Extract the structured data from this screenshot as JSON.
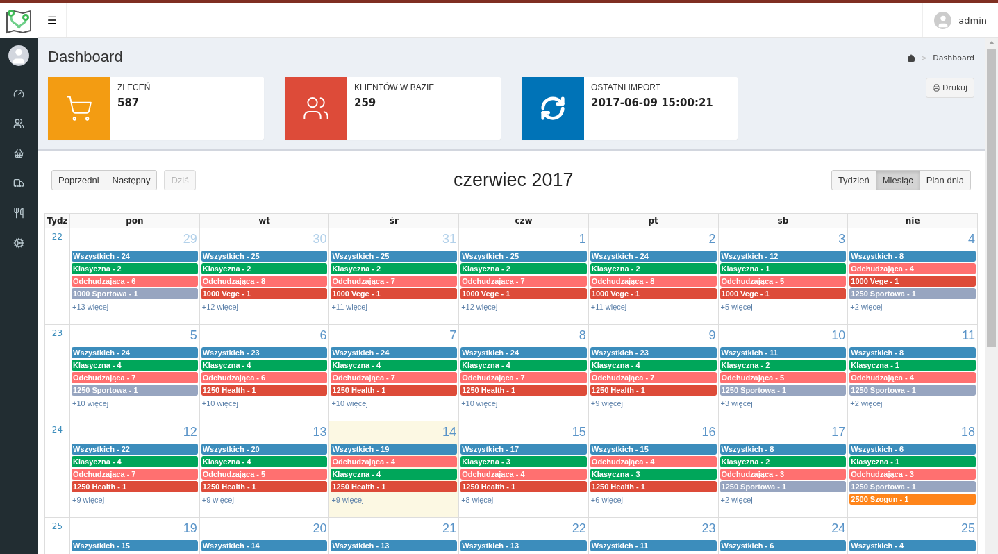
{
  "topbar": {
    "user": "admin"
  },
  "header": {
    "title": "Dashboard",
    "breadcrumb": [
      "Dashboard"
    ],
    "breadcrumb_separator": ">",
    "print_button": "Drukuj"
  },
  "info_boxes": [
    {
      "kind": "orders",
      "label": "ZLECEŃ",
      "value": "587",
      "color": "#f39c12"
    },
    {
      "kind": "clients",
      "label": "KLIENTÓW W BAZIE",
      "value": "259",
      "color": "#dd4b39"
    },
    {
      "kind": "import",
      "label": "OSTATNI IMPORT",
      "value": "2017-06-09 15:00:21",
      "color": "#0073b7"
    }
  ],
  "calendar": {
    "title": "czerwiec 2017",
    "nav_buttons": [
      {
        "label": "Poprzedni",
        "disabled": false
      },
      {
        "label": "Następny",
        "disabled": false
      }
    ],
    "today_button": {
      "label": "Dziś",
      "disabled": true
    },
    "views": [
      {
        "label": "Tydzień",
        "selected": false
      },
      {
        "label": "Miesiąc",
        "selected": true
      },
      {
        "label": "Plan dnia",
        "selected": false
      }
    ],
    "week_header": "Tydz",
    "columns": [
      "pon",
      "wt",
      "śr",
      "czw",
      "pt",
      "sb",
      "nie"
    ],
    "weeks": [
      {
        "number": "22",
        "days": [
          {
            "date": "29",
            "other_month": true,
            "today": false,
            "more": "+13 więcej",
            "events": [
              {
                "label": "Wszystkich - 24",
                "color": "#3c8dbc"
              },
              {
                "label": "Klasyczna - 2",
                "color": "#00a65a"
              },
              {
                "label": "Odchudzająca - 6",
                "color": "#ff7070"
              },
              {
                "label": "1000 Sportowa - 1",
                "color": "#97a5c0"
              }
            ]
          },
          {
            "date": "30",
            "other_month": true,
            "today": false,
            "more": "+12 więcej",
            "events": [
              {
                "label": "Wszystkich - 25",
                "color": "#3c8dbc"
              },
              {
                "label": "Klasyczna - 2",
                "color": "#00a65a"
              },
              {
                "label": "Odchudzająca - 8",
                "color": "#ff7070"
              },
              {
                "label": "1000 Vege - 1",
                "color": "#dd4b39"
              }
            ]
          },
          {
            "date": "31",
            "other_month": true,
            "today": false,
            "more": "+11 więcej",
            "events": [
              {
                "label": "Wszystkich - 25",
                "color": "#3c8dbc"
              },
              {
                "label": "Klasyczna - 2",
                "color": "#00a65a"
              },
              {
                "label": "Odchudzająca - 7",
                "color": "#ff7070"
              },
              {
                "label": "1000 Vege - 1",
                "color": "#dd4b39"
              }
            ]
          },
          {
            "date": "1",
            "other_month": false,
            "today": false,
            "more": "+12 więcej",
            "events": [
              {
                "label": "Wszystkich - 25",
                "color": "#3c8dbc"
              },
              {
                "label": "Klasyczna - 2",
                "color": "#00a65a"
              },
              {
                "label": "Odchudzająca - 7",
                "color": "#ff7070"
              },
              {
                "label": "1000 Vege - 1",
                "color": "#dd4b39"
              }
            ]
          },
          {
            "date": "2",
            "other_month": false,
            "today": false,
            "more": "+11 więcej",
            "events": [
              {
                "label": "Wszystkich - 24",
                "color": "#3c8dbc"
              },
              {
                "label": "Klasyczna - 2",
                "color": "#00a65a"
              },
              {
                "label": "Odchudzająca - 8",
                "color": "#ff7070"
              },
              {
                "label": "1000 Vege - 1",
                "color": "#dd4b39"
              }
            ]
          },
          {
            "date": "3",
            "other_month": false,
            "today": false,
            "more": "+5 więcej",
            "events": [
              {
                "label": "Wszystkich - 12",
                "color": "#3c8dbc"
              },
              {
                "label": "Klasyczna - 1",
                "color": "#00a65a"
              },
              {
                "label": "Odchudzająca - 5",
                "color": "#ff7070"
              },
              {
                "label": "1000 Vege - 1",
                "color": "#dd4b39"
              }
            ]
          },
          {
            "date": "4",
            "other_month": false,
            "today": false,
            "more": "+2 więcej",
            "events": [
              {
                "label": "Wszystkich - 8",
                "color": "#3c8dbc"
              },
              {
                "label": "Odchudzająca - 4",
                "color": "#ff7070"
              },
              {
                "label": "1000 Vege - 1",
                "color": "#dd4b39"
              },
              {
                "label": "1250 Sportowa - 1",
                "color": "#97a5c0"
              }
            ]
          }
        ]
      },
      {
        "number": "23",
        "days": [
          {
            "date": "5",
            "other_month": false,
            "today": false,
            "more": "+10 więcej",
            "events": [
              {
                "label": "Wszystkich - 24",
                "color": "#3c8dbc"
              },
              {
                "label": "Klasyczna - 4",
                "color": "#00a65a"
              },
              {
                "label": "Odchudzająca - 7",
                "color": "#ff7070"
              },
              {
                "label": "1250 Sportowa - 1",
                "color": "#97a5c0"
              }
            ]
          },
          {
            "date": "6",
            "other_month": false,
            "today": false,
            "more": "+10 więcej",
            "events": [
              {
                "label": "Wszystkich - 23",
                "color": "#3c8dbc"
              },
              {
                "label": "Klasyczna - 4",
                "color": "#00a65a"
              },
              {
                "label": "Odchudzająca - 6",
                "color": "#ff7070"
              },
              {
                "label": "1250 Health - 1",
                "color": "#dd4b39"
              }
            ]
          },
          {
            "date": "7",
            "other_month": false,
            "today": false,
            "more": "+10 więcej",
            "events": [
              {
                "label": "Wszystkich - 24",
                "color": "#3c8dbc"
              },
              {
                "label": "Klasyczna - 4",
                "color": "#00a65a"
              },
              {
                "label": "Odchudzająca - 7",
                "color": "#ff7070"
              },
              {
                "label": "1250 Health - 1",
                "color": "#dd4b39"
              }
            ]
          },
          {
            "date": "8",
            "other_month": false,
            "today": false,
            "more": "+10 więcej",
            "events": [
              {
                "label": "Wszystkich - 24",
                "color": "#3c8dbc"
              },
              {
                "label": "Klasyczna - 4",
                "color": "#00a65a"
              },
              {
                "label": "Odchudzająca - 7",
                "color": "#ff7070"
              },
              {
                "label": "1250 Health - 1",
                "color": "#dd4b39"
              }
            ]
          },
          {
            "date": "9",
            "other_month": false,
            "today": false,
            "more": "+9 więcej",
            "events": [
              {
                "label": "Wszystkich - 23",
                "color": "#3c8dbc"
              },
              {
                "label": "Klasyczna - 4",
                "color": "#00a65a"
              },
              {
                "label": "Odchudzająca - 7",
                "color": "#ff7070"
              },
              {
                "label": "1250 Health - 1",
                "color": "#dd4b39"
              }
            ]
          },
          {
            "date": "10",
            "other_month": false,
            "today": false,
            "more": "+3 więcej",
            "events": [
              {
                "label": "Wszystkich - 11",
                "color": "#3c8dbc"
              },
              {
                "label": "Klasyczna - 2",
                "color": "#00a65a"
              },
              {
                "label": "Odchudzająca - 5",
                "color": "#ff7070"
              },
              {
                "label": "1250 Sportowa - 1",
                "color": "#97a5c0"
              }
            ]
          },
          {
            "date": "11",
            "other_month": false,
            "today": false,
            "more": "+2 więcej",
            "events": [
              {
                "label": "Wszystkich - 8",
                "color": "#3c8dbc"
              },
              {
                "label": "Klasyczna - 1",
                "color": "#00a65a"
              },
              {
                "label": "Odchudzająca - 4",
                "color": "#ff7070"
              },
              {
                "label": "1250 Sportowa - 1",
                "color": "#97a5c0"
              }
            ]
          }
        ]
      },
      {
        "number": "24",
        "days": [
          {
            "date": "12",
            "other_month": false,
            "today": false,
            "more": "+9 więcej",
            "events": [
              {
                "label": "Wszystkich - 22",
                "color": "#3c8dbc"
              },
              {
                "label": "Klasyczna - 4",
                "color": "#00a65a"
              },
              {
                "label": "Odchudzająca - 7",
                "color": "#ff7070"
              },
              {
                "label": "1250 Health - 1",
                "color": "#dd4b39"
              }
            ]
          },
          {
            "date": "13",
            "other_month": false,
            "today": false,
            "more": "+9 więcej",
            "events": [
              {
                "label": "Wszystkich - 20",
                "color": "#3c8dbc"
              },
              {
                "label": "Klasyczna - 4",
                "color": "#00a65a"
              },
              {
                "label": "Odchudzająca - 5",
                "color": "#ff7070"
              },
              {
                "label": "1250 Health - 1",
                "color": "#dd4b39"
              }
            ]
          },
          {
            "date": "14",
            "other_month": false,
            "today": true,
            "more": "+9 więcej",
            "events": [
              {
                "label": "Wszystkich - 19",
                "color": "#3c8dbc"
              },
              {
                "label": "Odchudzająca - 4",
                "color": "#ff7070"
              },
              {
                "label": "Klasyczna - 4",
                "color": "#00a65a"
              },
              {
                "label": "1250 Health - 1",
                "color": "#dd4b39"
              }
            ]
          },
          {
            "date": "15",
            "other_month": false,
            "today": false,
            "more": "+8 więcej",
            "events": [
              {
                "label": "Wszystkich - 17",
                "color": "#3c8dbc"
              },
              {
                "label": "Klasyczna - 3",
                "color": "#00a65a"
              },
              {
                "label": "Odchudzająca - 4",
                "color": "#ff7070"
              },
              {
                "label": "1250 Health - 1",
                "color": "#dd4b39"
              }
            ]
          },
          {
            "date": "16",
            "other_month": false,
            "today": false,
            "more": "+6 więcej",
            "events": [
              {
                "label": "Wszystkich - 15",
                "color": "#3c8dbc"
              },
              {
                "label": "Odchudzająca - 4",
                "color": "#ff7070"
              },
              {
                "label": "Klasyczna - 3",
                "color": "#00a65a"
              },
              {
                "label": "1250 Health - 1",
                "color": "#dd4b39"
              }
            ]
          },
          {
            "date": "17",
            "other_month": false,
            "today": false,
            "more": "+2 więcej",
            "events": [
              {
                "label": "Wszystkich - 8",
                "color": "#3c8dbc"
              },
              {
                "label": "Klasyczna - 2",
                "color": "#00a65a"
              },
              {
                "label": "Odchudzająca - 3",
                "color": "#ff7070"
              },
              {
                "label": "1250 Sportowa - 1",
                "color": "#97a5c0"
              }
            ]
          },
          {
            "date": "18",
            "other_month": false,
            "today": false,
            "events": [
              {
                "label": "Wszystkich - 6",
                "color": "#3c8dbc"
              },
              {
                "label": "Klasyczna - 1",
                "color": "#00a65a"
              },
              {
                "label": "Odchudzająca - 3",
                "color": "#ff7070"
              },
              {
                "label": "1250 Sportowa - 1",
                "color": "#97a5c0"
              },
              {
                "label": "2500 Szogun - 1",
                "color": "#ff851b"
              }
            ]
          }
        ]
      },
      {
        "number": "25",
        "days": [
          {
            "date": "19",
            "other_month": false,
            "today": false,
            "events": [
              {
                "label": "Wszystkich - 15",
                "color": "#3c8dbc"
              }
            ]
          },
          {
            "date": "20",
            "other_month": false,
            "today": false,
            "events": [
              {
                "label": "Wszystkich - 14",
                "color": "#3c8dbc"
              }
            ]
          },
          {
            "date": "21",
            "other_month": false,
            "today": false,
            "events": [
              {
                "label": "Wszystkich - 13",
                "color": "#3c8dbc"
              }
            ]
          },
          {
            "date": "22",
            "other_month": false,
            "today": false,
            "events": [
              {
                "label": "Wszystkich - 13",
                "color": "#3c8dbc"
              }
            ]
          },
          {
            "date": "23",
            "other_month": false,
            "today": false,
            "events": [
              {
                "label": "Wszystkich - 11",
                "color": "#3c8dbc"
              }
            ]
          },
          {
            "date": "24",
            "other_month": false,
            "today": false,
            "events": [
              {
                "label": "Wszystkich - 6",
                "color": "#3c8dbc"
              }
            ]
          },
          {
            "date": "25",
            "other_month": false,
            "today": false,
            "events": [
              {
                "label": "Wszystkich - 4",
                "color": "#3c8dbc"
              }
            ]
          }
        ]
      }
    ]
  }
}
